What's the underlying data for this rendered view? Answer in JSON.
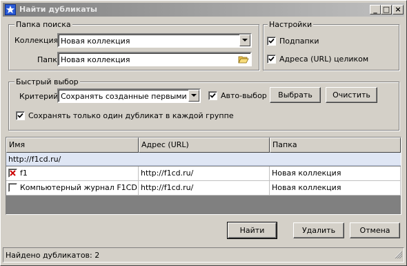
{
  "window": {
    "title": "Найти дубликаты",
    "buttons": {
      "minimize": "_",
      "maximize": "□",
      "close": "×"
    }
  },
  "search_folder": {
    "legend": "Папка поиска",
    "collection_label": "Коллекция",
    "collection_value": "Новая коллекция",
    "folder_label": "Папка",
    "folder_value": "Новая коллекция"
  },
  "settings": {
    "legend": "Настройки",
    "subfolders_label": "Подпапки",
    "subfolders_checked": true,
    "full_url_label": "Адреса (URL) целиком",
    "full_url_checked": true
  },
  "quick_select": {
    "legend": "Быстрый выбор",
    "criterion_label": "Критерий",
    "criterion_value": "Сохранять созданные первыми",
    "auto_label": "Авто-выбор",
    "auto_checked": true,
    "select_button": "Выбрать",
    "clear_button": "Очистить",
    "keep_one_label": "Сохранять только один дубликат в каждой группе",
    "keep_one_checked": true
  },
  "list": {
    "columns": [
      "Имя",
      "Адрес (URL)",
      "Папка"
    ],
    "group_header": "http://f1cd.ru/",
    "rows": [
      {
        "name": "f1",
        "url": "http://f1cd.ru/",
        "folder": "Новая коллекция",
        "marked": true
      },
      {
        "name": "Компьютерный журнал F1CD",
        "url": "http://f1cd.ru/",
        "folder": "Новая коллекция",
        "marked": false
      }
    ]
  },
  "actions": {
    "find": "Найти",
    "delete": "Удалить",
    "cancel": "Отмена"
  },
  "status": {
    "text": "Найдено дубликатов: 2"
  },
  "colors": {
    "face": "#d4d0c8",
    "title_gradient_start": "#808080",
    "title_gradient_end": "#c0c0c0",
    "group_row": "#dfe6f4",
    "mark_red": "#cc0000"
  },
  "icons": {
    "title": "star-icon",
    "browse": "folder-open-icon",
    "dropdown": "chevron-down-icon",
    "check": "check-icon",
    "delete_mark": "x-mark-icon",
    "grip": "resize-grip-icon"
  }
}
